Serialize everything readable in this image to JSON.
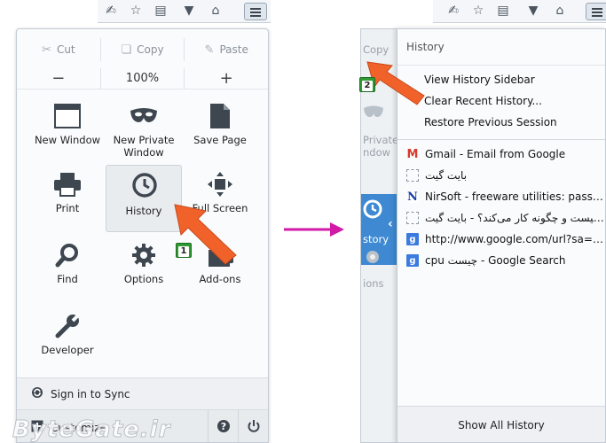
{
  "left_menu": {
    "edit": {
      "cut": "Cut",
      "copy": "Copy",
      "paste": "Paste"
    },
    "zoom": {
      "minus": "−",
      "level": "100%",
      "plus": "+"
    },
    "items": [
      {
        "label_1": "New Window",
        "label_2": ""
      },
      {
        "label_1": "New Private",
        "label_2": "Window"
      },
      {
        "label_1": "Save Page",
        "label_2": ""
      },
      {
        "label_1": "Print",
        "label_2": ""
      },
      {
        "label_1": "History",
        "label_2": ""
      },
      {
        "label_1": "Full Screen",
        "label_2": ""
      },
      {
        "label_1": "Find",
        "label_2": ""
      },
      {
        "label_1": "Options",
        "label_2": ""
      },
      {
        "label_1": "Add-ons",
        "label_2": ""
      },
      {
        "label_1": "Developer",
        "label_2": ""
      }
    ],
    "sync": "Sign in to Sync",
    "customize": "Customize",
    "help_icon": "question-icon",
    "quit_icon": "power-icon"
  },
  "badges": {
    "step1": "1",
    "step2": "2"
  },
  "watermark": "ByteGate.ir",
  "history_panel": {
    "title": "History",
    "view_sidebar": "View History Sidebar",
    "clear_recent": "Clear Recent History...",
    "restore_session": "Restore Previous Session",
    "entries": [
      {
        "text": "Gmail - Email from Google",
        "icon": "gmail-icon"
      },
      {
        "text": "بایت گیت",
        "icon": "blank-page-icon"
      },
      {
        "text": "NirSoft - freeware utilities: password re...",
        "icon": "nirsoft-icon"
      },
      {
        "text": "چیست و چگونه کار می‌کند؟ - بایت گیت CPU",
        "icon": "blank-page-icon"
      },
      {
        "text": "http://www.google.com/url?sa=t&rct...",
        "icon": "google-icon"
      },
      {
        "text": "cpu چیست - Google Search",
        "icon": "google-icon"
      }
    ],
    "show_all": "Show All History"
  },
  "back_panel": {
    "copy": "Copy",
    "private_1": "Private",
    "private_2": "ndow",
    "history": "story",
    "options": "ions"
  },
  "colors": {
    "accent_blue": "#3e89d2",
    "arrow_orange": "#f0622a",
    "transition_magenta": "#d21aa7",
    "badge_green": "#2f9b32"
  }
}
